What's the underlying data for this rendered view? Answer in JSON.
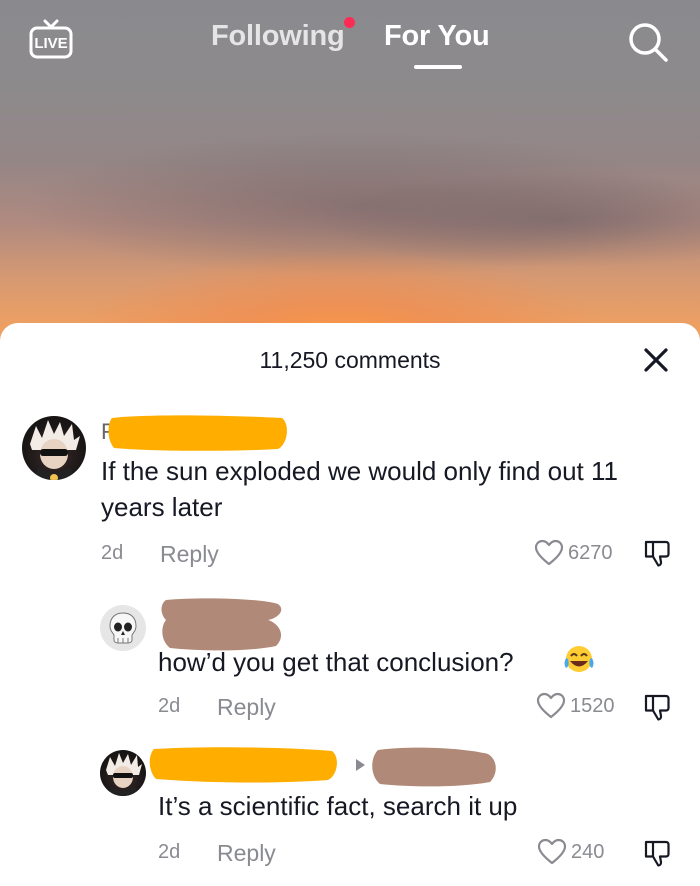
{
  "nav": {
    "live_label": "LIVE",
    "tabs": [
      {
        "label": "Following",
        "has_notification_dot": true
      },
      {
        "label": "For You",
        "active": true
      }
    ],
    "search_icon": "search-icon"
  },
  "comments_panel": {
    "title": "11,250 comments",
    "close_icon": "close-icon"
  },
  "comments": [
    {
      "level": 0,
      "author_visible_initial": "F",
      "author_redacted": true,
      "text": "If the sun exploded we would only find out 11 years later",
      "time": "2d",
      "reply_label": "Reply",
      "likes": "6270"
    },
    {
      "level": 1,
      "author_redacted": true,
      "text": "how’d you get that conclusion?",
      "emoji": "face-with-tears-of-joy",
      "time": "2d",
      "reply_label": "Reply",
      "likes": "1520"
    },
    {
      "level": 1,
      "author_redacted": true,
      "reply_to_redacted": true,
      "text": "It’s a scientific fact, search it up",
      "time": "2d",
      "reply_label": "Reply",
      "likes": "240"
    }
  ],
  "colors": {
    "accent_red": "#fe2c55",
    "redaction_orange": "#ffae00",
    "redaction_brown": "#b08978",
    "muted_text": "#8a8b91",
    "text": "#161823"
  }
}
